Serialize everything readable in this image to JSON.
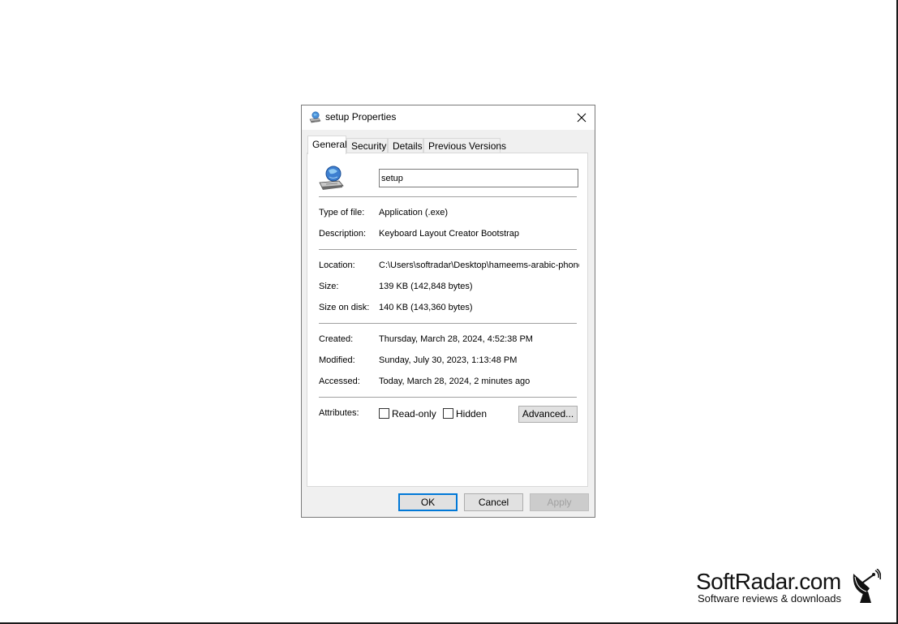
{
  "window": {
    "title": "setup Properties",
    "icon": "setup-exe-icon"
  },
  "tabs": [
    {
      "label": "General",
      "active": true
    },
    {
      "label": "Security",
      "active": false
    },
    {
      "label": "Details",
      "active": false
    },
    {
      "label": "Previous Versions",
      "active": false
    }
  ],
  "general": {
    "file_name": "setup",
    "rows": {
      "type": {
        "label": "Type of file:",
        "value": "Application (.exe)"
      },
      "description": {
        "label": "Description:",
        "value": "Keyboard Layout Creator Bootstrap"
      },
      "location": {
        "label": "Location:",
        "value": "C:\\Users\\softradar\\Desktop\\hameems-arabic-phone"
      },
      "size": {
        "label": "Size:",
        "value": "139 KB (142,848 bytes)"
      },
      "size_on_disk": {
        "label": "Size on disk:",
        "value": "140 KB (143,360 bytes)"
      },
      "created": {
        "label": "Created:",
        "value": "Thursday, March 28, 2024, 4:52:38 PM"
      },
      "modified": {
        "label": "Modified:",
        "value": "Sunday, July 30, 2023, 1:13:48 PM"
      },
      "accessed": {
        "label": "Accessed:",
        "value": "Today, March 28, 2024, 2 minutes ago"
      }
    },
    "attributes": {
      "label": "Attributes:",
      "read_only": {
        "label": "Read-only",
        "checked": false
      },
      "hidden": {
        "label": "Hidden",
        "checked": false
      },
      "advanced_button": "Advanced..."
    }
  },
  "buttons": {
    "ok": "OK",
    "cancel": "Cancel",
    "apply": "Apply"
  },
  "watermark": {
    "title": "SoftRadar.com",
    "subtitle": "Software reviews & downloads",
    "icon": "satellite-dish-icon"
  },
  "colors": {
    "accent": "#0078d7",
    "dialog_bg": "#f0f0f0",
    "panel_bg": "#ffffff",
    "border": "#7a7a7a"
  }
}
